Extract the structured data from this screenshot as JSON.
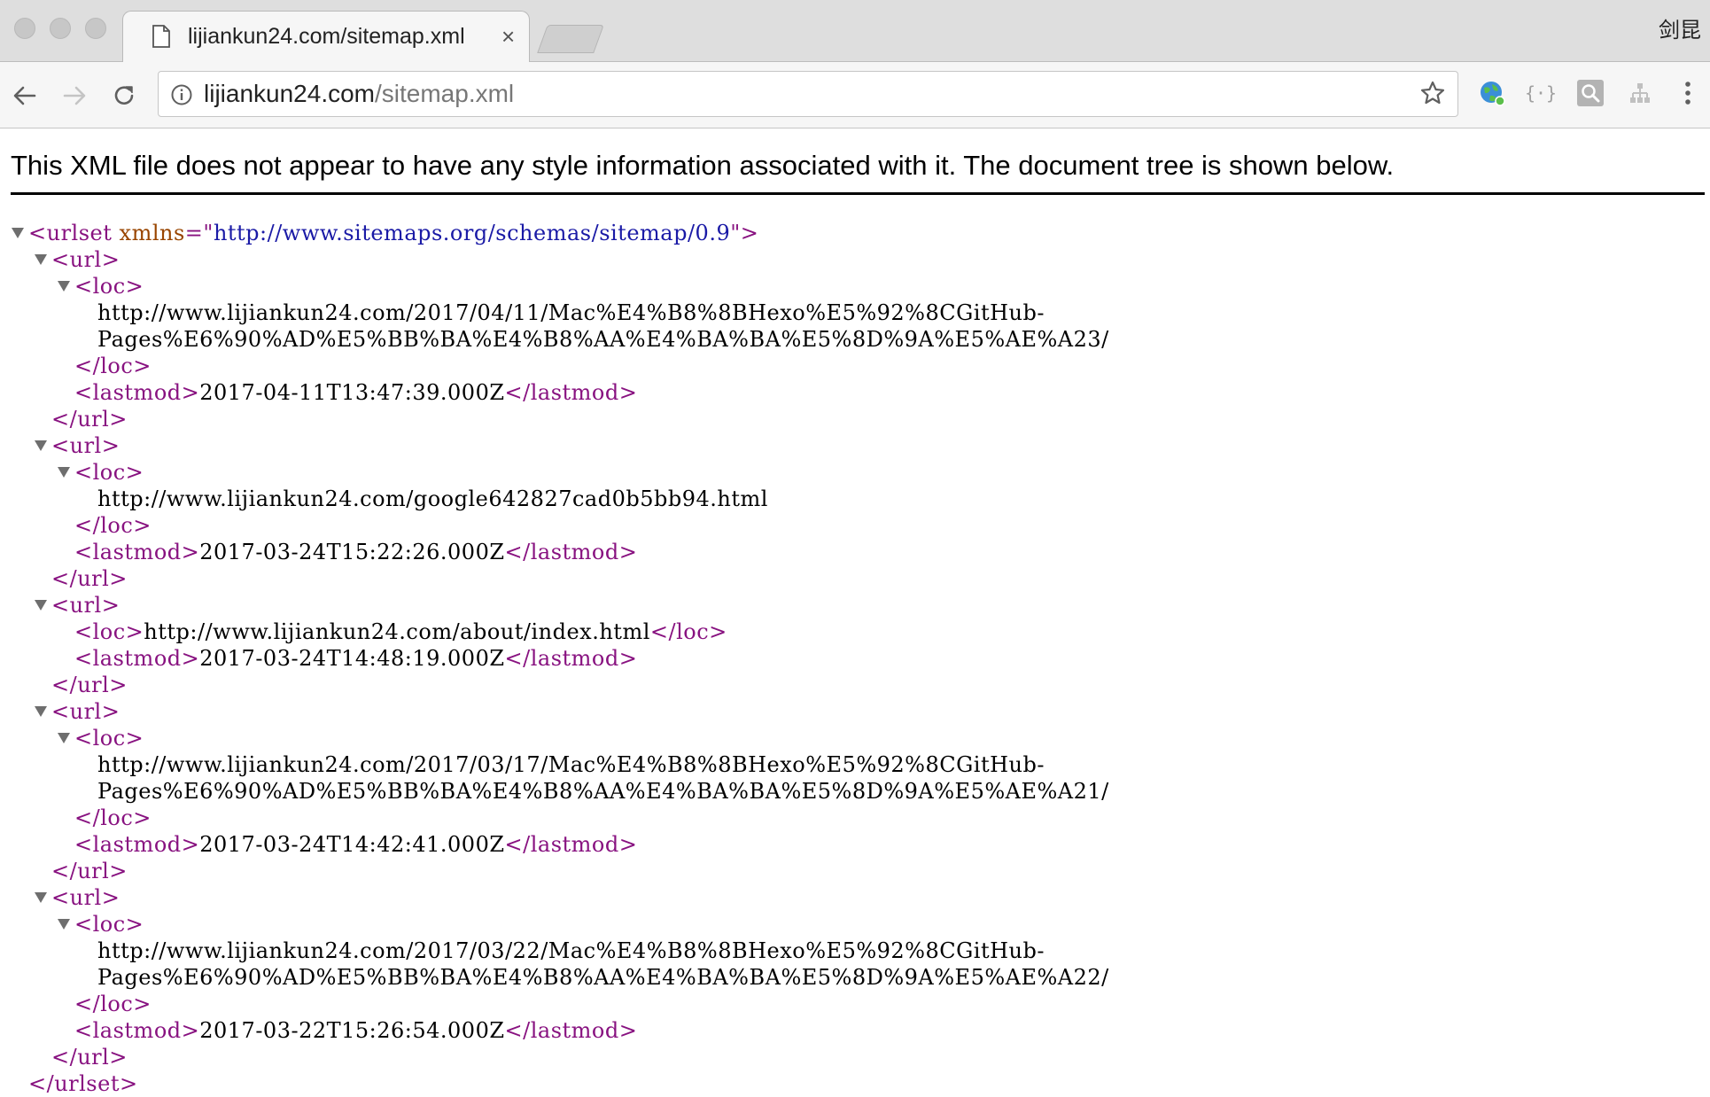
{
  "window": {
    "tab_title": "lijiankun24.com/sitemap.xml",
    "tab_close": "×",
    "profile_name": "剑昆"
  },
  "toolbar": {
    "url_host": "lijiankun24.com",
    "url_path": "/sitemap.xml"
  },
  "page": {
    "notice": "This XML file does not appear to have any style information associated with it. The document tree is shown below."
  },
  "xml": {
    "urlset_open": "<urlset",
    "xmlns_attr": "xmlns",
    "eq_quote": "=\"",
    "xmlns_value": "http://www.sitemaps.org/schemas/sitemap/0.9",
    "close_quote_gt": "\">",
    "urlset_close": "</urlset>",
    "url_open": "<url>",
    "url_close": "</url>",
    "loc_open": "<loc>",
    "loc_close": "</loc>",
    "lastmod_open": "<lastmod>",
    "lastmod_close": "</lastmod>",
    "entries": [
      {
        "loc_line1": "http://www.lijiankun24.com/2017/04/11/Mac%E4%B8%8BHexo%E5%92%8CGitHub-",
        "loc_line2": "Pages%E6%90%AD%E5%BB%BA%E4%B8%AA%E4%BA%BA%E5%8D%9A%E5%AE%A23/",
        "lastmod": "2017-04-11T13:47:39.000Z"
      },
      {
        "loc_line1": "http://www.lijiankun24.com/google642827cad0b5bb94.html",
        "lastmod": "2017-03-24T15:22:26.000Z"
      },
      {
        "loc_inline": "http://www.lijiankun24.com/about/index.html",
        "lastmod": "2017-03-24T14:48:19.000Z"
      },
      {
        "loc_line1": "http://www.lijiankun24.com/2017/03/17/Mac%E4%B8%8BHexo%E5%92%8CGitHub-",
        "loc_line2": "Pages%E6%90%AD%E5%BB%BA%E4%B8%AA%E4%BA%BA%E5%8D%9A%E5%AE%A21/",
        "lastmod": "2017-03-24T14:42:41.000Z"
      },
      {
        "loc_line1": "http://www.lijiankun24.com/2017/03/22/Mac%E4%B8%8BHexo%E5%92%8CGitHub-",
        "loc_line2": "Pages%E6%90%AD%E5%BB%BA%E4%B8%AA%E4%BA%BA%E5%8D%9A%E5%AE%A22/",
        "lastmod": "2017-03-22T15:26:54.000Z"
      }
    ]
  },
  "icons": {
    "back": "arrow-left-icon",
    "forward": "arrow-right-icon",
    "reload": "reload-icon",
    "info": "info-icon",
    "star": "star-icon",
    "menu": "kebab-menu-icon"
  }
}
